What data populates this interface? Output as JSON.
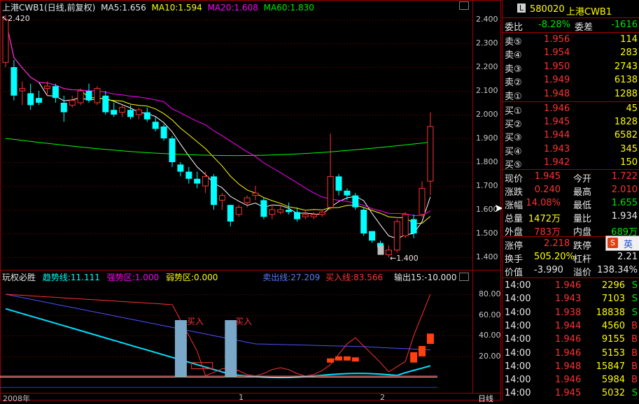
{
  "price_panel": {
    "title": "上港CWB1(日线,前复权)",
    "ma5": "MA5:1.656",
    "ma10": "MA10:1.594",
    "ma20": "MA20:1.608",
    "ma60": "MA60:1.830",
    "high_mark": "2.420",
    "low_mark": "1.400",
    "y_ticks": [
      "2.400",
      "2.300",
      "2.200",
      "2.100",
      "2.000",
      "1.900",
      "1.800",
      "1.700",
      "1.600",
      "1.500",
      "1.400"
    ]
  },
  "indicator_panel": {
    "name": "玩权必胜",
    "trend": "趋势线:11.111",
    "strong": "强势区:1.000",
    "weak": "弱势区:0.000",
    "sell_line": "卖出线:27.209",
    "buy_line": "买入线:83.566",
    "output": "输出15:-10.000",
    "buy_label_1": "买入",
    "buy_label_2": "买入",
    "y_ticks": [
      "80.00",
      "60.00",
      "40.00",
      "20.00"
    ]
  },
  "time_axis": {
    "label_year": "2008年",
    "tick_1": "1",
    "tick_2": "2",
    "period": "日线"
  },
  "quote": {
    "code": "580020",
    "name": "上港CWB1",
    "wei_bi_label": "委比",
    "wei_bi": "-8.28%",
    "wei_cha_label": "委差",
    "wei_cha": "-1616",
    "asks": [
      {
        "label": "卖⑤",
        "price": "1.956",
        "vol": "114"
      },
      {
        "label": "卖④",
        "price": "1.954",
        "vol": "283"
      },
      {
        "label": "卖③",
        "price": "1.950",
        "vol": "2743"
      },
      {
        "label": "卖②",
        "price": "1.949",
        "vol": "6138"
      },
      {
        "label": "卖①",
        "price": "1.948",
        "vol": "1288"
      }
    ],
    "bids": [
      {
        "label": "买①",
        "price": "1.946",
        "vol": "45"
      },
      {
        "label": "买②",
        "price": "1.945",
        "vol": "1828"
      },
      {
        "label": "买③",
        "price": "1.944",
        "vol": "6582"
      },
      {
        "label": "买④",
        "price": "1.943",
        "vol": "345"
      },
      {
        "label": "买⑤",
        "price": "1.942",
        "vol": "150"
      }
    ],
    "stats": [
      {
        "l1": "现价",
        "v1": "1.945",
        "l2": "今开",
        "v2": "1.722"
      },
      {
        "l1": "涨跌",
        "v1": "0.240",
        "l2": "最高",
        "v2": "2.010"
      },
      {
        "l1": "涨幅",
        "v1": "14.08%",
        "l2": "最低",
        "v2": "1.655"
      },
      {
        "l1": "总量",
        "v1": "1472万",
        "l2": "量比",
        "v2": "1.934"
      },
      {
        "l1": "外盘",
        "v1": "783万",
        "l2": "内盘",
        "v2": "689万"
      }
    ],
    "limit_up_label": "涨停",
    "limit_up": "2.218",
    "limit_down_label": "跌停",
    "ime": "英",
    "turnover_label": "换手",
    "turnover": "505.20%",
    "leverage_label": "杠杆",
    "leverage": "2.21",
    "value_label": "价值",
    "value": "-3.990",
    "premium_label": "溢价",
    "premium": "138.34%"
  },
  "ticks": [
    {
      "time": "14:00",
      "price": "1.946",
      "vol": "2296",
      "side": "S"
    },
    {
      "time": "14:00",
      "price": "1.943",
      "vol": "7103",
      "side": "S"
    },
    {
      "time": "14:00",
      "price": "1.938",
      "vol": "18838",
      "side": "S"
    },
    {
      "time": "14:00",
      "price": "1.944",
      "vol": "4560",
      "side": "B"
    },
    {
      "time": "14:00",
      "price": "1.946",
      "vol": "9155",
      "side": "B"
    },
    {
      "time": "14:00",
      "price": "1.946",
      "vol": "5153",
      "side": "B"
    },
    {
      "time": "14:00",
      "price": "1.948",
      "vol": "15847",
      "side": "B"
    },
    {
      "time": "14:00",
      "price": "1.946",
      "vol": "5984",
      "side": "B"
    },
    {
      "time": "14:00",
      "price": "1.945",
      "vol": "5032",
      "side": "S"
    }
  ],
  "candles": [
    {
      "o": 2.22,
      "h": 2.42,
      "l": 2.2,
      "c": 2.4
    },
    {
      "o": 2.2,
      "h": 2.23,
      "l": 2.06,
      "c": 2.08
    },
    {
      "o": 2.1,
      "h": 2.14,
      "l": 2.04,
      "c": 2.11
    },
    {
      "o": 2.09,
      "h": 2.13,
      "l": 2.02,
      "c": 2.04
    },
    {
      "o": 2.07,
      "h": 2.1,
      "l": 2.04,
      "c": 2.05
    },
    {
      "o": 2.11,
      "h": 2.14,
      "l": 2.08,
      "c": 2.12
    },
    {
      "o": 2.12,
      "h": 2.13,
      "l": 2.05,
      "c": 2.07
    },
    {
      "o": 2.05,
      "h": 2.08,
      "l": 1.97,
      "c": 2.01
    },
    {
      "o": 2.04,
      "h": 2.08,
      "l": 2.03,
      "c": 2.06
    },
    {
      "o": 2.05,
      "h": 2.11,
      "l": 2.04,
      "c": 2.1
    },
    {
      "o": 2.1,
      "h": 2.13,
      "l": 2.05,
      "c": 2.06
    },
    {
      "o": 2.05,
      "h": 2.12,
      "l": 2.04,
      "c": 2.11
    },
    {
      "o": 2.08,
      "h": 2.1,
      "l": 2.0,
      "c": 2.01
    },
    {
      "o": 2.02,
      "h": 2.05,
      "l": 1.99,
      "c": 2.0
    },
    {
      "o": 2.01,
      "h": 2.04,
      "l": 1.99,
      "c": 2.03
    },
    {
      "o": 2.02,
      "h": 2.04,
      "l": 1.98,
      "c": 1.99
    },
    {
      "o": 2.0,
      "h": 2.03,
      "l": 1.98,
      "c": 2.02
    },
    {
      "o": 2.01,
      "h": 2.03,
      "l": 1.97,
      "c": 1.98
    },
    {
      "o": 1.97,
      "h": 1.99,
      "l": 1.93,
      "c": 1.94
    },
    {
      "o": 1.95,
      "h": 1.96,
      "l": 1.89,
      "c": 1.9
    },
    {
      "o": 1.9,
      "h": 1.91,
      "l": 1.78,
      "c": 1.8
    },
    {
      "o": 1.79,
      "h": 1.8,
      "l": 1.74,
      "c": 1.76
    },
    {
      "o": 1.76,
      "h": 1.78,
      "l": 1.71,
      "c": 1.73
    },
    {
      "o": 1.73,
      "h": 1.76,
      "l": 1.69,
      "c": 1.71
    },
    {
      "o": 1.7,
      "h": 1.76,
      "l": 1.67,
      "c": 1.74
    },
    {
      "o": 1.74,
      "h": 1.75,
      "l": 1.6,
      "c": 1.62
    },
    {
      "o": 1.64,
      "h": 1.67,
      "l": 1.6,
      "c": 1.66
    },
    {
      "o": 1.62,
      "h": 1.62,
      "l": 1.53,
      "c": 1.55
    },
    {
      "o": 1.58,
      "h": 1.62,
      "l": 1.57,
      "c": 1.61
    },
    {
      "o": 1.63,
      "h": 1.66,
      "l": 1.61,
      "c": 1.65
    },
    {
      "o": 1.66,
      "h": 1.7,
      "l": 1.64,
      "c": 1.67
    },
    {
      "o": 1.64,
      "h": 1.65,
      "l": 1.56,
      "c": 1.57
    },
    {
      "o": 1.58,
      "h": 1.62,
      "l": 1.56,
      "c": 1.6
    },
    {
      "o": 1.59,
      "h": 1.62,
      "l": 1.58,
      "c": 1.6
    },
    {
      "o": 1.6,
      "h": 1.63,
      "l": 1.58,
      "c": 1.59
    },
    {
      "o": 1.59,
      "h": 1.61,
      "l": 1.55,
      "c": 1.56
    },
    {
      "o": 1.57,
      "h": 1.6,
      "l": 1.56,
      "c": 1.58
    },
    {
      "o": 1.57,
      "h": 1.59,
      "l": 1.56,
      "c": 1.58
    },
    {
      "o": 1.58,
      "h": 1.6,
      "l": 1.57,
      "c": 1.59
    },
    {
      "o": 1.61,
      "h": 1.92,
      "l": 1.6,
      "c": 1.74
    },
    {
      "o": 1.74,
      "h": 1.75,
      "l": 1.66,
      "c": 1.68
    },
    {
      "o": 1.68,
      "h": 1.69,
      "l": 1.64,
      "c": 1.66
    },
    {
      "o": 1.66,
      "h": 1.67,
      "l": 1.6,
      "c": 1.61
    },
    {
      "o": 1.6,
      "h": 1.61,
      "l": 1.49,
      "c": 1.5
    },
    {
      "o": 1.51,
      "h": 1.51,
      "l": 1.46,
      "c": 1.47
    },
    {
      "o": 1.46,
      "h": 1.47,
      "l": 1.43,
      "c": 1.44
    },
    {
      "o": 1.41,
      "h": 1.45,
      "l": 1.4,
      "c": 1.43
    },
    {
      "o": 1.43,
      "h": 1.56,
      "l": 1.42,
      "c": 1.55
    },
    {
      "o": 1.49,
      "h": 1.59,
      "l": 1.48,
      "c": 1.58
    },
    {
      "o": 1.56,
      "h": 1.58,
      "l": 1.48,
      "c": 1.5
    },
    {
      "o": 1.58,
      "h": 1.72,
      "l": 1.57,
      "c": 1.69
    },
    {
      "o": 1.72,
      "h": 2.01,
      "l": 1.66,
      "c": 1.95
    }
  ],
  "colors": {
    "up": "#ff3232",
    "down": "#00ffff",
    "ma5": "#ffffff",
    "ma10": "#ffff00",
    "ma20": "#ff00ff",
    "ma60": "#00ff00",
    "grid": "#8b0000",
    "trend": "#ffffff",
    "strong": "#ff00ff",
    "weak": "#ffff00",
    "sell": "#5050ff",
    "buy": "#ff3232"
  }
}
